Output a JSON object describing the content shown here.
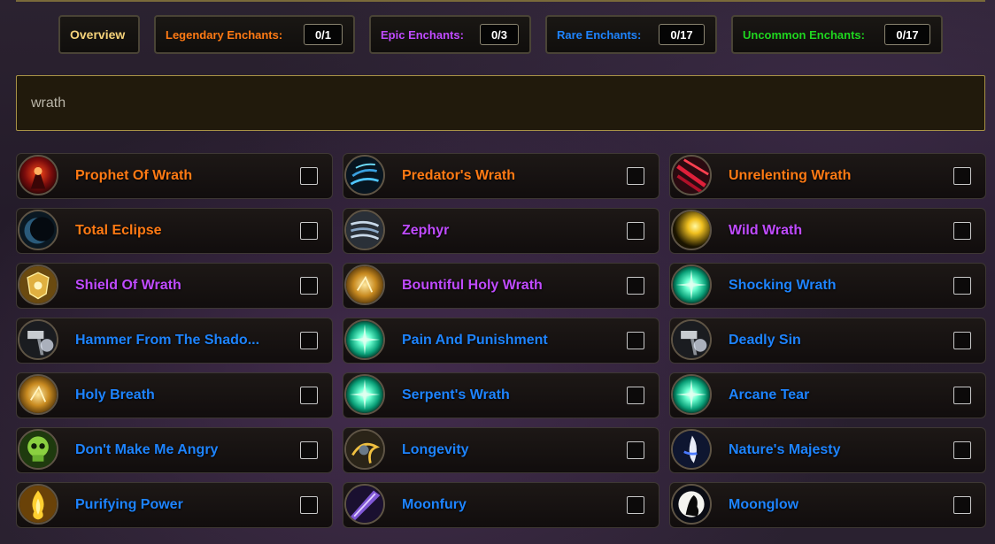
{
  "filters": {
    "overview_label": "Overview",
    "legendary": {
      "label": "Legendary Enchants:",
      "count": "0/1"
    },
    "epic": {
      "label": "Epic Enchants:",
      "count": "0/3"
    },
    "rare": {
      "label": "Rare Enchants:",
      "count": "0/17"
    },
    "uncommon": {
      "label": "Uncommon Enchants:",
      "count": "0/17"
    }
  },
  "search": {
    "value": "wrath"
  },
  "colors": {
    "legendary": "#ff7a14",
    "epic": "#c04bff",
    "rare": "#1e84ff",
    "uncommon": "#1fd51f"
  },
  "enchants": [
    {
      "name": "Prophet Of Wrath",
      "rarity": "legendary",
      "icon": "red-demon-icon",
      "checked": false
    },
    {
      "name": "Predator's Wrath",
      "rarity": "legendary",
      "icon": "blue-claw-icon",
      "checked": false
    },
    {
      "name": "Unrelenting Wrath",
      "rarity": "legendary",
      "icon": "red-slash-icon",
      "checked": false
    },
    {
      "name": "Total Eclipse",
      "rarity": "legendary",
      "icon": "eclipse-icon",
      "checked": false
    },
    {
      "name": "Zephyr",
      "rarity": "epic",
      "icon": "wind-icon",
      "checked": false
    },
    {
      "name": "Wild Wrath",
      "rarity": "epic",
      "icon": "yellow-burst-icon",
      "checked": false
    },
    {
      "name": "Shield Of Wrath",
      "rarity": "epic",
      "icon": "golden-shield-icon",
      "checked": false
    },
    {
      "name": "Bountiful Holy Wrath",
      "rarity": "epic",
      "icon": "holy-light-icon",
      "checked": false
    },
    {
      "name": "Shocking Wrath",
      "rarity": "rare",
      "icon": "green-spark-icon",
      "checked": false
    },
    {
      "name": "Hammer From The Shado...",
      "rarity": "rare",
      "icon": "shadow-hammer-icon",
      "checked": false
    },
    {
      "name": "Pain And Punishment",
      "rarity": "rare",
      "icon": "green-spark-icon",
      "checked": false
    },
    {
      "name": "Deadly Sin",
      "rarity": "rare",
      "icon": "shadow-hammer-icon",
      "checked": false
    },
    {
      "name": "Holy Breath",
      "rarity": "rare",
      "icon": "holy-light-icon",
      "checked": false
    },
    {
      "name": "Serpent's Wrath",
      "rarity": "rare",
      "icon": "green-spark-icon",
      "checked": false
    },
    {
      "name": "Arcane Tear",
      "rarity": "rare",
      "icon": "green-spark-icon",
      "checked": false
    },
    {
      "name": "Don't Make Me Angry",
      "rarity": "rare",
      "icon": "green-skull-icon",
      "checked": false
    },
    {
      "name": "Longevity",
      "rarity": "rare",
      "icon": "storm-icon",
      "checked": false
    },
    {
      "name": "Nature's Majesty",
      "rarity": "rare",
      "icon": "blue-spirit-icon",
      "checked": false
    },
    {
      "name": "Purifying Power",
      "rarity": "rare",
      "icon": "golden-flame-icon",
      "checked": false
    },
    {
      "name": "Moonfury",
      "rarity": "rare",
      "icon": "purple-beam-icon",
      "checked": false
    },
    {
      "name": "Moonglow",
      "rarity": "rare",
      "icon": "raven-moon-icon",
      "checked": false
    }
  ]
}
